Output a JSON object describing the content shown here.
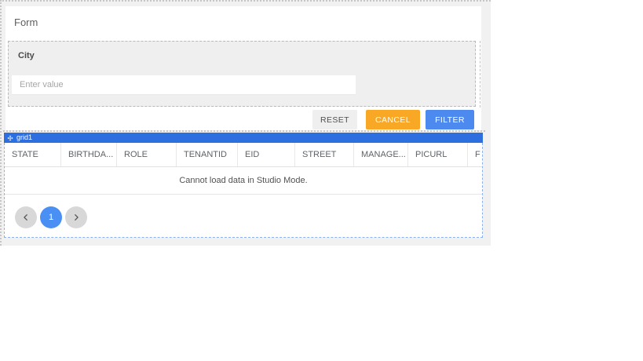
{
  "form": {
    "title": "Form",
    "filter": {
      "label": "City",
      "placeholder": "Enter value"
    },
    "buttons": {
      "reset": "RESET",
      "cancel": "CANCEL",
      "filter": "FILTER"
    }
  },
  "grid": {
    "widget_name": "grid1",
    "columns": [
      "STATE",
      "BIRTHDA...",
      "ROLE",
      "TENANTID",
      "EID",
      "STREET",
      "MANAGE...",
      "PICURL",
      "F"
    ],
    "empty_message": "Cannot load data in Studio Mode.",
    "pagination": {
      "current_page": "1",
      "prev_icon": "chevron-left",
      "next_icon": "chevron-right"
    },
    "move_icon": "move"
  },
  "colors": {
    "canvas_bg": "#f1f1f1",
    "widget_name_bar_blue": "#2d6fdf",
    "filter_button_blue": "#4d8af0",
    "cancel_button_orange": "#f9a825",
    "reset_button_gray": "#efefef",
    "pagination_active_blue": "#4a90f4",
    "selection_border_blue": "#8ab1f2"
  }
}
